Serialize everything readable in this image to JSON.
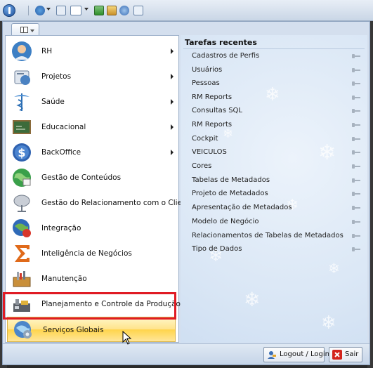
{
  "menu": {
    "items": [
      {
        "label": "RH",
        "icon": "user-head-icon",
        "submenu": true
      },
      {
        "label": "Projetos",
        "icon": "projects-icon",
        "submenu": true
      },
      {
        "label": "Saúde",
        "icon": "caduceus-icon",
        "submenu": true
      },
      {
        "label": "Educacional",
        "icon": "chalkboard-icon",
        "submenu": true
      },
      {
        "label": "BackOffice",
        "icon": "dollar-icon",
        "submenu": true
      },
      {
        "label": "Gestão de Conteúdos",
        "icon": "content-globe-icon",
        "submenu": false
      },
      {
        "label": "Gestão do Relacionamento com o Cliente",
        "icon": "crm-satellite-icon",
        "submenu": false
      },
      {
        "label": "Integração",
        "icon": "integration-globe-icon",
        "submenu": false
      },
      {
        "label": "Inteligência de Negócios",
        "icon": "sigma-icon",
        "submenu": false
      },
      {
        "label": "Manutenção",
        "icon": "toolbox-icon",
        "submenu": false
      },
      {
        "label": "Planejamento e Controle da Produção",
        "icon": "production-icon",
        "submenu": false
      },
      {
        "label": "Serviços Globais",
        "icon": "global-services-icon",
        "submenu": false,
        "selected": true
      }
    ]
  },
  "recent": {
    "title": "Tarefas recentes",
    "items": [
      "Cadastros de Perfis",
      "Usuários",
      "Pessoas",
      "RM Reports",
      "Consultas SQL",
      "RM Reports",
      "Cockpit",
      "VEICULOS",
      "Cores",
      "Tabelas de Metadados",
      "Projeto de Metadados",
      "Apresentação de Metadados",
      "Modelo de Negócio",
      "Relacionamentos de Tabelas de Metadados",
      "Tipo de Dados"
    ]
  },
  "footer": {
    "logout_label": "Logout / Login",
    "exit_label": "Sair"
  },
  "colors": {
    "selected_highlight": "#ffd44a",
    "selection_frame": "#e01b24",
    "panel_blue": "#d4dfee"
  }
}
